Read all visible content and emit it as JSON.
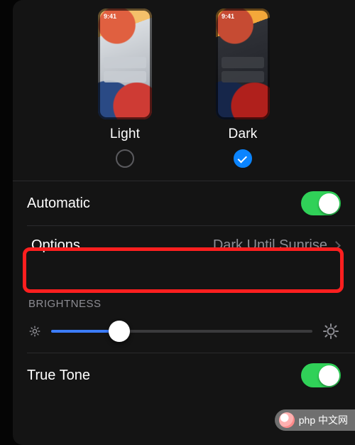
{
  "appearance": {
    "preview_time": "9:41",
    "options": [
      {
        "label": "Light",
        "selected": false
      },
      {
        "label": "Dark",
        "selected": true
      }
    ]
  },
  "automatic": {
    "label": "Automatic",
    "enabled": true
  },
  "schedule": {
    "label": "Options",
    "value": "Dark Until Sunrise"
  },
  "brightness": {
    "section_label": "BRIGHTNESS",
    "value_percent": 26
  },
  "true_tone": {
    "label": "True Tone",
    "enabled": true
  },
  "watermark": "php 中文网",
  "colors": {
    "accent": "#0a84ff",
    "toggle_on": "#30d158",
    "highlight": "#ff1f1f"
  }
}
